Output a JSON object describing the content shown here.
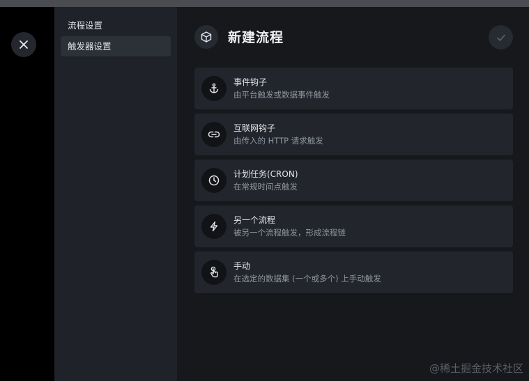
{
  "sidebar": {
    "items": [
      {
        "label": "流程设置",
        "active": false
      },
      {
        "label": "触发器设置",
        "active": true
      }
    ]
  },
  "header": {
    "title": "新建流程",
    "icon": "cube-icon"
  },
  "triggers": [
    {
      "title": "事件钩子",
      "subtitle": "由平台触发或数据事件触发",
      "icon": "anchor-icon"
    },
    {
      "title": "互联网钩子",
      "subtitle": "由传入的 HTTP 请求触发",
      "icon": "link-icon"
    },
    {
      "title": "计划任务(CRON)",
      "subtitle": "在常规时间点触发",
      "icon": "clock-icon"
    },
    {
      "title": "另一个流程",
      "subtitle": "被另一个流程触发，形成流程链",
      "icon": "bolt-icon"
    },
    {
      "title": "手动",
      "subtitle": "在选定的数据集 (一个或多个) 上手动触发",
      "icon": "touch-icon"
    }
  ],
  "watermark": "@稀土掘金技术社区",
  "colors": {
    "background": "#000000",
    "sidebar": "#1f2228",
    "main": "#16181c",
    "card": "#22252b",
    "active_nav": "#2c3037"
  }
}
